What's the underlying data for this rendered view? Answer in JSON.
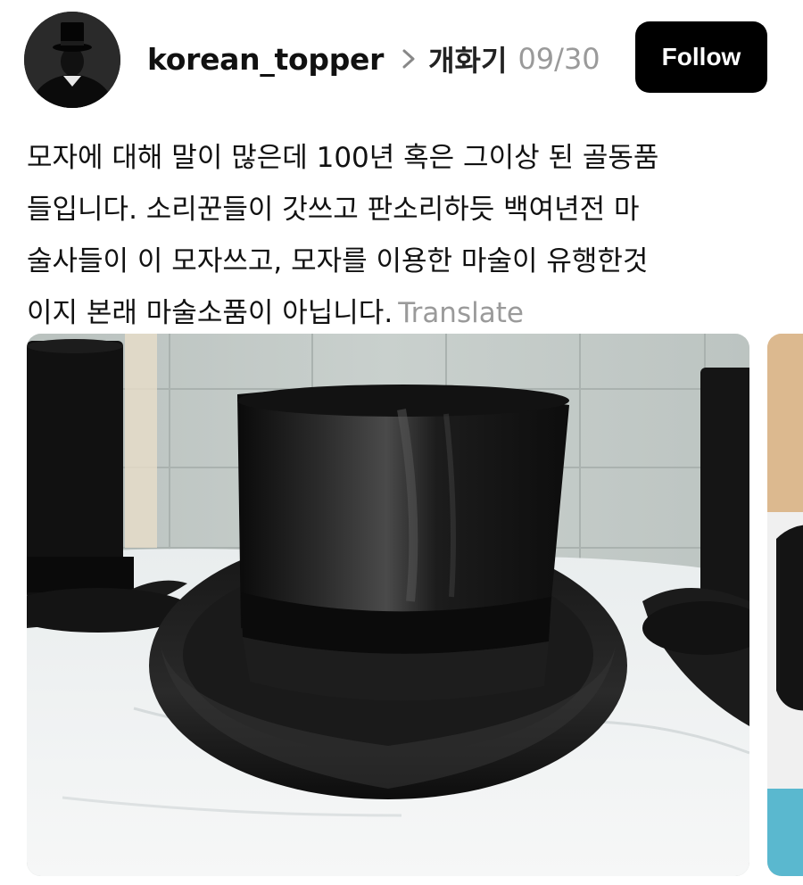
{
  "post": {
    "username": "korean_topper",
    "topic": "개화기",
    "date": "09/30",
    "follow_label": "Follow",
    "body_lines": [
      "모자에 대해 말이 많은데 100년 혹은 그이상 된 골동품",
      "들입니다. 소리꾼들이 갓쓰고 판소리하듯 백여년전 마",
      "술사들이 이 모자쓰고, 모자를 이용한 마술이 유행한것",
      "이지 본래 마술소품이 아닙니다."
    ],
    "translate_label": "Translate"
  },
  "media": {
    "main_image": "top-hats-photo",
    "next_image": "top-hat-photo-peek"
  },
  "colors": {
    "follow_bg": "#000000",
    "follow_text": "#ffffff",
    "muted": "#9a9a9a",
    "text": "#111111"
  },
  "icons": [
    "profile-avatar",
    "chevron-right-icon"
  ]
}
